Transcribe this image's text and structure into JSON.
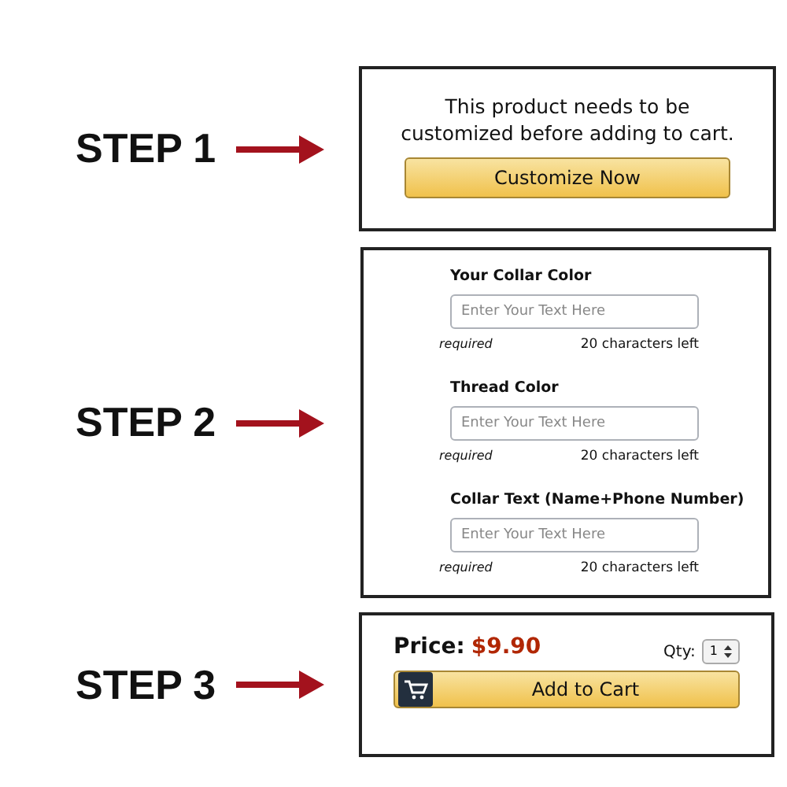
{
  "steps": [
    {
      "label": "STEP 1",
      "kind": "notice",
      "message": "This product needs to be customized before adding to cart.",
      "button": "Customize Now"
    },
    {
      "label": "STEP 2",
      "kind": "form",
      "fields": [
        {
          "label": "Your Collar Color",
          "placeholder": "Enter Your Text Here",
          "note": "required",
          "counter": "20 characters left"
        },
        {
          "label": "Thread Color",
          "placeholder": "Enter Your Text Here",
          "note": "required",
          "counter": "20 characters left"
        },
        {
          "label": "Collar Text (Name+Phone Number)",
          "placeholder": "Enter Your Text Here",
          "note": "required",
          "counter": "20 characters left"
        }
      ]
    },
    {
      "label": "STEP 3",
      "kind": "cart",
      "price_label": "Price:",
      "price": "$9.90",
      "qty_label": "Qty:",
      "qty": "1",
      "button": "Add to Cart"
    }
  ]
}
